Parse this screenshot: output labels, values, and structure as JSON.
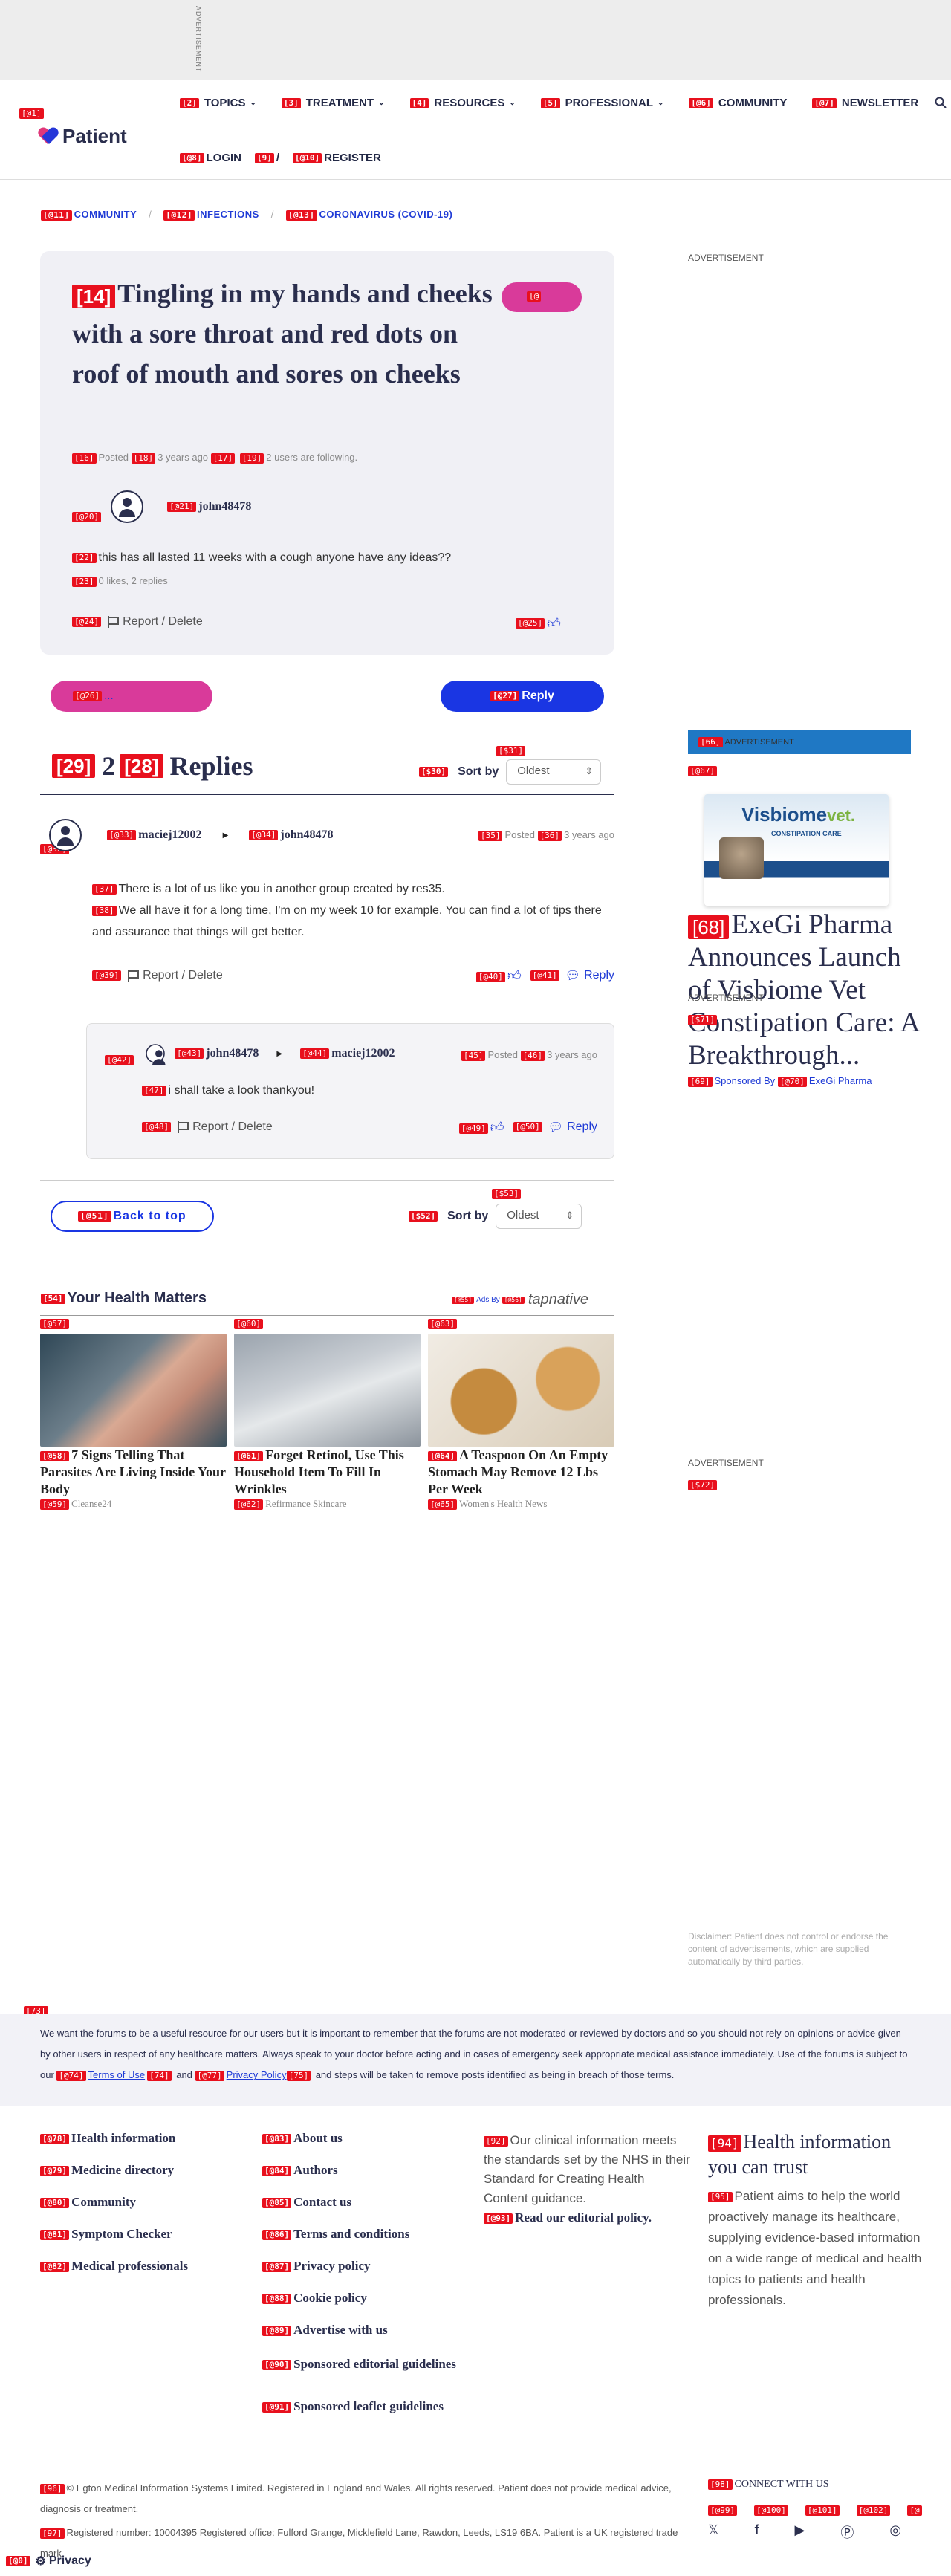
{
  "top_ad": {
    "label": "ADVERTISEMENT"
  },
  "header": {
    "logo_text": "Patient",
    "marks": {
      "logo": "[@1]",
      "topics": "[2]",
      "treatment": "[3]",
      "resources": "[4]",
      "professional": "[5]",
      "community": "[@6]",
      "newsletter": "[@7]",
      "login": "[@8]",
      "sep": "[9]",
      "register": "[@10]"
    },
    "nav": {
      "topics": "TOPICS",
      "treatment": "TREATMENT",
      "resources": "RESOURCES",
      "professional": "PROFESSIONAL",
      "community": "COMMUNITY",
      "newsletter": "NEWSLETTER"
    },
    "login": "LOGIN",
    "separator": "/",
    "register": "REGISTER"
  },
  "breadcrumb": {
    "marks": [
      "[@11]",
      "[@12]",
      "[@13]"
    ],
    "items": [
      "COMMUNITY",
      "INFECTIONS",
      "CORONAVIRUS (COVID-19)"
    ],
    "sep": "/"
  },
  "post": {
    "title_mark": "[14]",
    "title": "Tingling in my hands and cheeks with a sore throat and red dots on roof of mouth and sores on cheeks",
    "follow_mark": "[@",
    "meta": {
      "m16": "[16]",
      "posted": "Posted",
      "m18": "[18]",
      "ago": "3 years ago",
      "m17": "[17]",
      "m19": "[19]",
      "following": "2 users are following."
    },
    "avatar_mark": "[@20]",
    "author_mark": "[@21]",
    "author": "john48478",
    "body_mark": "[22]",
    "body": "this has all lasted 11 weeks with a cough anyone have any ideas??",
    "likes_mark": "[23]",
    "likes": "0 likes, 2 replies",
    "report_mark": "[@24]",
    "report": "Report / Delete",
    "like_mark": "[@25]"
  },
  "actions": {
    "pink_mark": "[@26]",
    "pink_label": "...",
    "reply_mark": "[@27]",
    "reply_label": "Reply"
  },
  "replies_header": {
    "m29": "[29]",
    "count": "2",
    "m28": "[28]",
    "label": "Replies",
    "sort_mark": "[$30]",
    "sort_label": "Sort by",
    "top_mark": "[$31]",
    "select_value": "Oldest"
  },
  "reply1": {
    "avatar_mark": "[@32]",
    "author_mark": "[@33]",
    "author": "maciej12002",
    "to_mark": "[@34]",
    "to": "john48478",
    "m35": "[35]",
    "posted": "Posted",
    "m36": "[36]",
    "ago": "3 years ago",
    "lines": [
      {
        "mark": "[37]",
        "text": "There is a lot of us like you in another group created by res35."
      },
      {
        "mark": "[38]",
        "text": "We all have it for a long time, I'm on my week 10 for example. You can find a lot of tips there and assurance that things will get better."
      }
    ],
    "report_mark": "[@39]",
    "report": "Report / Delete",
    "like_mark": "[@40]",
    "reply_mark": "[@41]",
    "reply": "Reply"
  },
  "reply2": {
    "avatar_mark": "[@42]",
    "author_mark": "[@43]",
    "author": "john48478",
    "to_mark": "[@44]",
    "to": "maciej12002",
    "m45": "[45]",
    "posted": "Posted",
    "m46": "[46]",
    "ago": "3 years ago",
    "text_mark": "[47]",
    "text": "i shall take a look thankyou!",
    "report_mark": "[@48]",
    "report": "Report / Delete",
    "like_mark": "[@49]",
    "reply_mark": "[@50]",
    "reply": "Reply"
  },
  "bottom_bar": {
    "back_mark": "[@51]",
    "back": "Back to top",
    "sort_mark": "[$52]",
    "sort_label": "Sort by",
    "top_mark": "[$53]",
    "select_value": "Oldest"
  },
  "health": {
    "title_mark": "[54]",
    "title": "Your Health Matters",
    "ads_mark": "[@55]",
    "ads_by": "Ads By",
    "tap_mark": "[@56]",
    "tapnative": "tapnative",
    "cards": [
      {
        "img_mark": "[@57]",
        "title_mark": "[@58]",
        "title": "7 Signs Telling That Parasites Are Living Inside Your Body",
        "src_mark": "[@59]",
        "source": "Cleanse24"
      },
      {
        "img_mark": "[@60]",
        "title_mark": "[@61]",
        "title": "Forget Retinol, Use This Household Item To Fill In Wrinkles",
        "src_mark": "[@62]",
        "source": "Refirmance Skincare"
      },
      {
        "img_mark": "[@63]",
        "title_mark": "[@64]",
        "title": "A Teaspoon On An Empty Stomach May Remove 12 Lbs Per Week",
        "src_mark": "[@65]",
        "source": "Women's Health News"
      }
    ]
  },
  "sidebar": {
    "ad_label": "ADVERTISEMENT",
    "ad_bar_mark": "[66]",
    "ad_bar_text": "ADVERTISEMENT",
    "img_mark": "[@67]",
    "visbiome_brand": "Visbiome",
    "visbiome_vet": "vet.",
    "visbiome_sub": "CONSTIPATION CARE",
    "overlap_label": "ADVERTISEMENT",
    "overlap_mark": "[$71]",
    "headline_mark": "[68]",
    "headline": "ExeGi Pharma Announces Launch of Visbiome Vet Constipation Care: A Breakthrough...",
    "sponsor_mark": "[69]",
    "sponsored_by": "Sponsored By",
    "sponsor_name_mark": "[@70]",
    "sponsor_name": "ExeGi Pharma",
    "ad2_label": "ADVERTISEMENT",
    "ad2_mark": "[$72]",
    "disclaimer": "Disclaimer: Patient does not control or endorse the content of advertisements, which are supplied automatically by third parties."
  },
  "notice": {
    "mark": "[73]",
    "text1": "We want the forums to be a useful resource for our users but it is important to remember that the forums are not moderated or reviewed by doctors and so you should not rely on opinions or advice given by other users in respect of any healthcare matters. Always speak to your doctor before acting and in cases of emergency seek appropriate medical assistance immediately. Use of the forums is subject to our ",
    "tou_mark": "[@74]",
    "terms": "Terms of Use",
    "m74b": "[74]",
    "and": " and ",
    "pp_mark": "[@77]",
    "privacy": "Privacy Policy",
    "m75": "[75]",
    "text2": " and steps will be taken to remove posts identified as being in breach of those terms."
  },
  "footer": {
    "col1": [
      {
        "mark": "[@78]",
        "label": "Health information"
      },
      {
        "mark": "[@79]",
        "label": "Medicine directory"
      },
      {
        "mark": "[@80]",
        "label": "Community"
      },
      {
        "mark": "[@81]",
        "label": "Symptom Checker"
      },
      {
        "mark": "[@82]",
        "label": "Medical professionals"
      }
    ],
    "col2": [
      {
        "mark": "[@83]",
        "label": "About us"
      },
      {
        "mark": "[@84]",
        "label": "Authors"
      },
      {
        "mark": "[@85]",
        "label": "Contact us"
      },
      {
        "mark": "[@86]",
        "label": "Terms and conditions"
      },
      {
        "mark": "[@87]",
        "label": "Privacy policy"
      },
      {
        "mark": "[@88]",
        "label": "Cookie policy"
      },
      {
        "mark": "[@89]",
        "label": "Advertise with us"
      },
      {
        "mark": "[@90]",
        "label": "Sponsored editorial guidelines"
      },
      {
        "mark": "[@91]",
        "label": "Sponsored leaflet guidelines"
      }
    ],
    "clinical_mark": "[92]",
    "clinical": "Our clinical information meets the standards set by the NHS in their Standard for Creating Health Content guidance.",
    "policy_mark": "[@93]",
    "policy": "Read our editorial policy.",
    "trust_mark": "[94]",
    "trust_title": "Health information you can trust",
    "trust_text_mark": "[95]",
    "trust_text": "Patient aims to help the world proactively manage its healthcare, supplying evidence-based information on a wide range of medical and health topics to patients and health professionals.",
    "copy_mark": "[96]",
    "copy": "© Egton Medical Information Systems Limited. Registered in England and Wales. All rights reserved. Patient does not provide medical advice, diagnosis or treatment.",
    "reg_mark": "[97]",
    "reg": "Registered number: 10004395 Registered office: Fulford Grange, Micklefield Lane, Rawdon, Leeds, LS19 6BA. Patient is a UK registered trade mark.",
    "connect_mark": "[98]",
    "connect": "CONNECT WITH US",
    "social_marks": [
      "[@99]",
      "[@100]",
      "[@101]",
      "[@102]",
      "[@"
    ],
    "social_icons": [
      "twitter-icon",
      "facebook-icon",
      "youtube-icon",
      "pinterest-icon",
      "instagram-icon"
    ],
    "privacy_mark": "[@0]",
    "privacy_label": "Privacy"
  }
}
